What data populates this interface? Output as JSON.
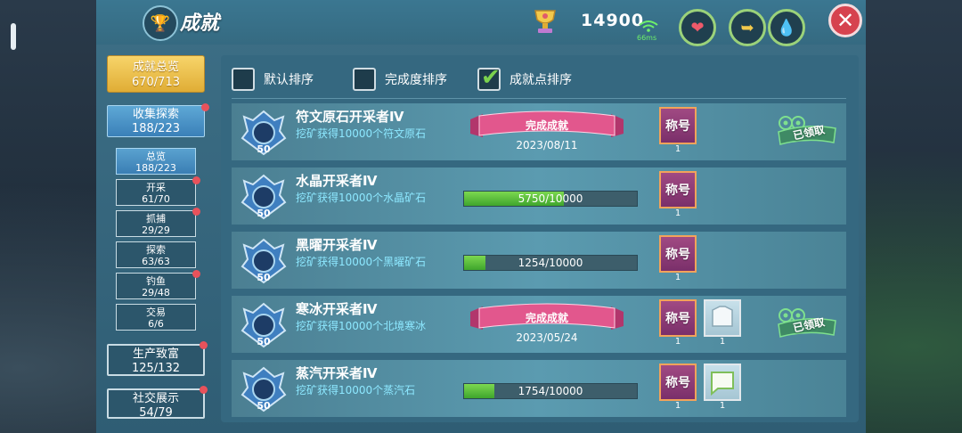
{
  "header": {
    "title": "成就",
    "score": "14900",
    "ping": "66ms",
    "icons": [
      "trophy-icon",
      "gold-cup-icon",
      "wifi-icon",
      "heart-icon",
      "arrow-icon",
      "drop-icon",
      "close-icon"
    ],
    "close_label": "✕"
  },
  "sidebar": {
    "summary": {
      "label": "成就总览",
      "count": "670/713"
    },
    "categories": [
      {
        "label": "收集探索",
        "count": "188/223"
      },
      {
        "label": "生产致富",
        "count": "125/132"
      },
      {
        "label": "社交展示",
        "count": "54/79"
      }
    ],
    "sub_items": [
      {
        "label": "总览",
        "count": "188/223"
      },
      {
        "label": "开采",
        "count": "61/70"
      },
      {
        "label": "抓捕",
        "count": "29/29"
      },
      {
        "label": "探索",
        "count": "63/63"
      },
      {
        "label": "钓鱼",
        "count": "29/48"
      },
      {
        "label": "交易",
        "count": "6/6"
      }
    ]
  },
  "sort_options": [
    {
      "label": "默认排序",
      "checked": false
    },
    {
      "label": "完成度排序",
      "checked": false
    },
    {
      "label": "成就点排序",
      "checked": true
    }
  ],
  "achievements": [
    {
      "name": "符文原石开采者Ⅳ",
      "desc": "挖矿获得10000个符文原石",
      "points": "50",
      "status": "完成成就",
      "date": "2023/08/11",
      "rewards": [
        {
          "label": "称号",
          "count": "1"
        }
      ],
      "claimed": "已领取"
    },
    {
      "name": "水晶开采者Ⅳ",
      "desc": "挖矿获得10000个水晶矿石",
      "points": "50",
      "progress_text": "5750/10000",
      "progress": 0.575,
      "rewards": [
        {
          "label": "称号",
          "count": "1"
        }
      ]
    },
    {
      "name": "黑曜开采者Ⅳ",
      "desc": "挖矿获得10000个黑曜矿石",
      "points": "50",
      "progress_text": "1254/10000",
      "progress": 0.1254,
      "rewards": [
        {
          "label": "称号",
          "count": "1"
        }
      ]
    },
    {
      "name": "寒冰开采者Ⅳ",
      "desc": "挖矿获得10000个北境寒冰",
      "points": "50",
      "status": "完成成就",
      "date": "2023/05/24",
      "rewards": [
        {
          "label": "称号",
          "count": "1"
        },
        {
          "label": "",
          "count": "1"
        }
      ],
      "claimed": "已领取"
    },
    {
      "name": "蒸汽开采者Ⅳ",
      "desc": "挖矿获得10000个蒸汽石",
      "points": "50",
      "progress_text": "1754/10000",
      "progress": 0.1754,
      "rewards": [
        {
          "label": "称号",
          "count": "1"
        },
        {
          "label": "",
          "count": "1"
        }
      ]
    }
  ],
  "colors": {
    "accent_green": "#6fd24a",
    "ribbon_pink": "#e2578d",
    "title_purple": "#8e3a78",
    "close_red": "#d6434f",
    "desc_cyan": "#8de8ff"
  }
}
